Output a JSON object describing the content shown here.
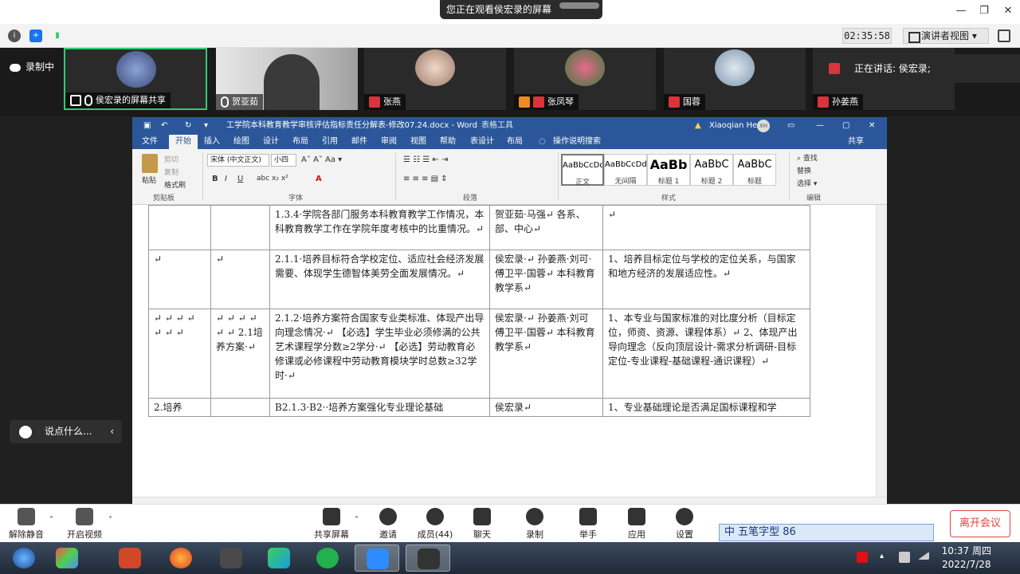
{
  "screen_share_banner": "您正在观看侯宏录的屏幕",
  "meeting_timer": "02:35:58",
  "view_mode": "演讲者视图",
  "recording_label": "录制中",
  "participants": [
    {
      "name": "侯宏录的屏幕共享",
      "muted": false
    },
    {
      "name": "贺亚茹",
      "muted": false
    },
    {
      "name": "张燕",
      "muted": true
    },
    {
      "name": "张凤琴",
      "muted": true
    },
    {
      "name": "国蓉",
      "muted": true
    },
    {
      "name": "孙姜燕",
      "muted": true
    }
  ],
  "speaking_label": "正在讲话: 侯宏录;",
  "word": {
    "title": "工学院本科教育教学审核评估指标责任分解表-修改07.24.docx  -  Word",
    "context_tab": "表格工具",
    "user": "Xiaoqian He",
    "user_initials": "XH",
    "tabs": [
      "文件",
      "开始",
      "插入",
      "绘图",
      "设计",
      "布局",
      "引用",
      "邮件",
      "审阅",
      "视图",
      "帮助",
      "表设计",
      "布局"
    ],
    "search_hint": "操作说明搜索",
    "share_label": "共享",
    "ribbon": {
      "clipboard_label": "剪贴板",
      "paste": "粘贴",
      "cut": "剪切",
      "copy": "复制",
      "format_painter": "格式刷",
      "font_name": "宋体 (中文正文)",
      "font_size": "小四",
      "font_label": "字体",
      "paragraph_label": "段落",
      "styles_label": "样式",
      "editing_label": "编辑",
      "find": "查找",
      "replace": "替换",
      "select": "选择",
      "styles": [
        {
          "preview": "AaBbCcDdI",
          "name": "正文"
        },
        {
          "preview": "AaBbCcDdI",
          "name": "无间隔"
        },
        {
          "preview": "AaBb",
          "name": "标题 1"
        },
        {
          "preview": "AaBbC",
          "name": "标题 2"
        },
        {
          "preview": "AaBbC",
          "name": "标题"
        }
      ]
    },
    "table_rows": [
      {
        "c1": "",
        "c2": "",
        "c3": "1.3.4·学院各部门服务本科教育教学工作情况，本科教育教学工作在学院年度考核中的比重情况。↵",
        "c4": "贺亚茹·马强↵ 各系、部、中心↵",
        "c5": "↵"
      },
      {
        "c1": "↵",
        "c2": "↵",
        "c3": "2.1.1·培养目标符合学校定位、适应社会经济发展需要、体现学生德智体美劳全面发展情况。↵",
        "c4": "侯宏录·↵ 孙姜燕·刘可·傅卫平·国蓉↵ 本科教育教学系↵",
        "c5": "1、培养目标定位与学校的定位关系，与国家和地方经济的发展适应性。↵"
      },
      {
        "c1": "↵ ↵ ↵ ↵ ↵ ↵ ↵",
        "c2": "↵ ↵ ↵ ↵ ↵ ↵ 2.1培养方案·↵",
        "c3": "2.1.2·培养方案符合国家专业类标准、体现产出导向理念情况·↵ 【必选】学生毕业必须修满的公共艺术课程学分数≥2学分·↵ 【必选】劳动教育必修课或必修课程中劳动教育模块学时总数≥32学时·↵",
        "c4": "侯宏录·↵ 孙姜燕·刘可傅卫平·国蓉↵ 本科教育教学系↵",
        "c5": "1、本专业与国家标准的对比度分析（目标定位，师资、资源、课程体系）↵ 2、体现产出导向理念（反向顶层设计-需求分析调研-目标定位-专业课程-基础课程-通识课程）↵"
      },
      {
        "c1": "2.培养",
        "c2": "",
        "c3": "B2.1.3·B2··培养方案强化专业理论基础",
        "c4": "侯宏录↵",
        "c5": "1、专业基础理论是否满足国标课程和学"
      }
    ]
  },
  "chat_placeholder": "说点什么...",
  "zoom_toolbar": {
    "unmute": "解除静音",
    "start_video": "开启视频",
    "share_screen": "共享屏幕",
    "invite": "邀请",
    "members": "成员(44)",
    "chat": "聊天",
    "record": "录制",
    "raise_hand": "举手",
    "apps": "应用",
    "settings": "设置",
    "leave": "离开会议"
  },
  "ime_text": "中 五笔字型 86",
  "taskbar": {
    "time": "10:37 周四",
    "date": "2022/7/28"
  },
  "colors": {
    "word_blue": "#2b579a",
    "leave_red": "#e04646",
    "active_green": "#2ecc71"
  }
}
